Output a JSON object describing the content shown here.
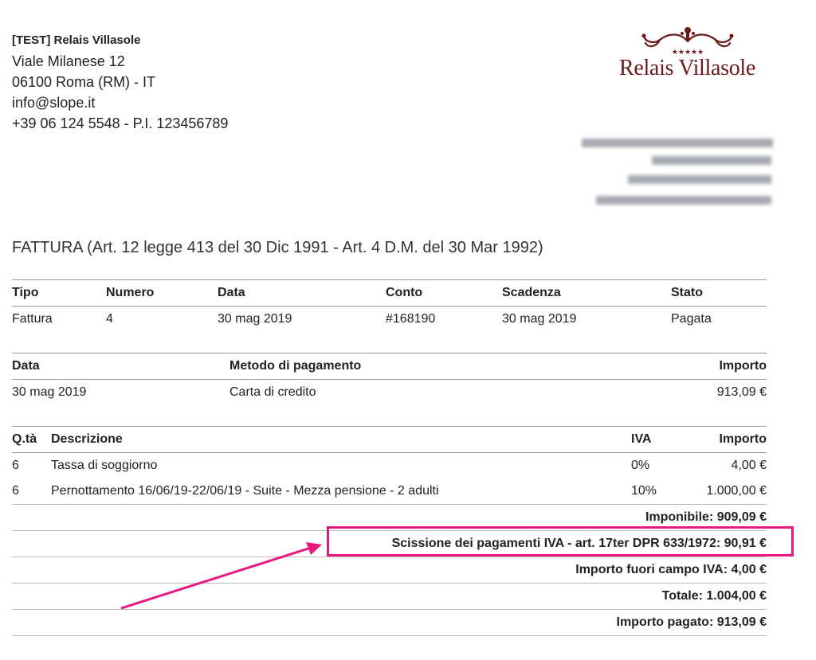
{
  "sender": {
    "name": "[TEST] Relais Villasole",
    "address": "Viale Milanese 12",
    "city": "06100 Roma (RM) - IT",
    "email": "info@slope.it",
    "phone_vat": "+39 06 124 5548 - P.I. 123456789"
  },
  "logo": {
    "text": "Relais Villasole",
    "stars": "★★★★★"
  },
  "document_title": "FATTURA (Art. 12 legge 413 del 30 Dic 1991 - Art. 4 D.M. del 30 Mar 1992)",
  "invoice_table": {
    "headers": [
      "Tipo",
      "Numero",
      "Data",
      "Conto",
      "Scadenza",
      "Stato"
    ],
    "row": [
      "Fattura",
      "4",
      "30 mag 2019",
      "#168190",
      "30 mag 2019",
      "Pagata"
    ]
  },
  "payments_table": {
    "headers": [
      "Data",
      "Metodo di pagamento",
      "Importo"
    ],
    "row": [
      "30 mag 2019",
      "Carta di credito",
      "913,09 €"
    ]
  },
  "items_table": {
    "headers": [
      "Q.tà",
      "Descrizione",
      "IVA",
      "Importo"
    ],
    "rows": [
      [
        "6",
        "Tassa di soggiorno",
        "0%",
        "4,00 €"
      ],
      [
        "6",
        "Pernottamento 16/06/19-22/06/19 - Suite - Mezza pensione - 2 adulti",
        "10%",
        "1.000,00 €"
      ]
    ]
  },
  "summary": {
    "imponibile": "Imponibile: 909,09 €",
    "scissione": "Scissione dei pagamenti IVA - art. 17ter DPR 633/1972: 90,91 €",
    "fuori_campo": "Importo fuori campo IVA: 4,00 €",
    "totale": "Totale: 1.004,00 €",
    "pagato": "Importo pagato: 913,09 €"
  },
  "colors": {
    "highlight": "#e8187f",
    "logo": "#6b1a1a"
  }
}
